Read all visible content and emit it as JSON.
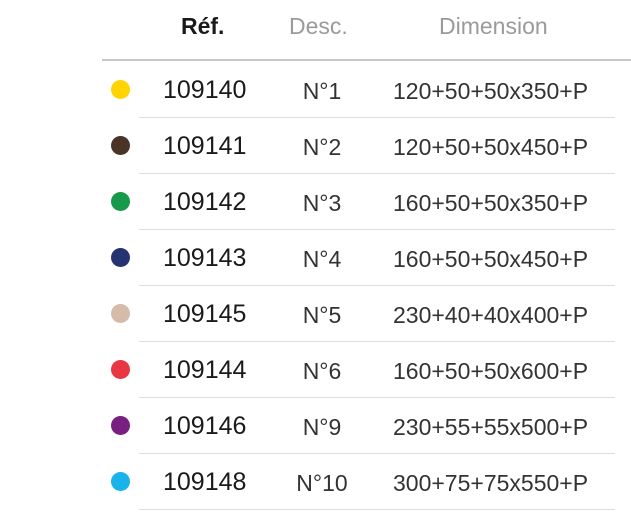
{
  "header": {
    "ref": "Réf.",
    "desc": "Desc.",
    "dimension": "Dimension"
  },
  "rows": [
    {
      "color": "#ffd400",
      "ref": "109140",
      "desc": "N°1",
      "dimension": "120+50+50x350+P"
    },
    {
      "color": "#4a3428",
      "ref": "109141",
      "desc": "N°2",
      "dimension": "120+50+50x450+P"
    },
    {
      "color": "#16994a",
      "ref": "109142",
      "desc": "N°3",
      "dimension": "160+50+50x350+P"
    },
    {
      "color": "#263373",
      "ref": "109143",
      "desc": "N°4",
      "dimension": "160+50+50x450+P"
    },
    {
      "color": "#d5bcaa",
      "ref": "109145",
      "desc": "N°5",
      "dimension": "230+40+40x400+P"
    },
    {
      "color": "#e83642",
      "ref": "109144",
      "desc": "N°6",
      "dimension": "160+50+50x600+P"
    },
    {
      "color": "#7a1f82",
      "ref": "109146",
      "desc": "N°9",
      "dimension": "230+55+55x500+P"
    },
    {
      "color": "#17b3ea",
      "ref": "109148",
      "desc": "N°10",
      "dimension": "300+75+75x550+P"
    }
  ]
}
